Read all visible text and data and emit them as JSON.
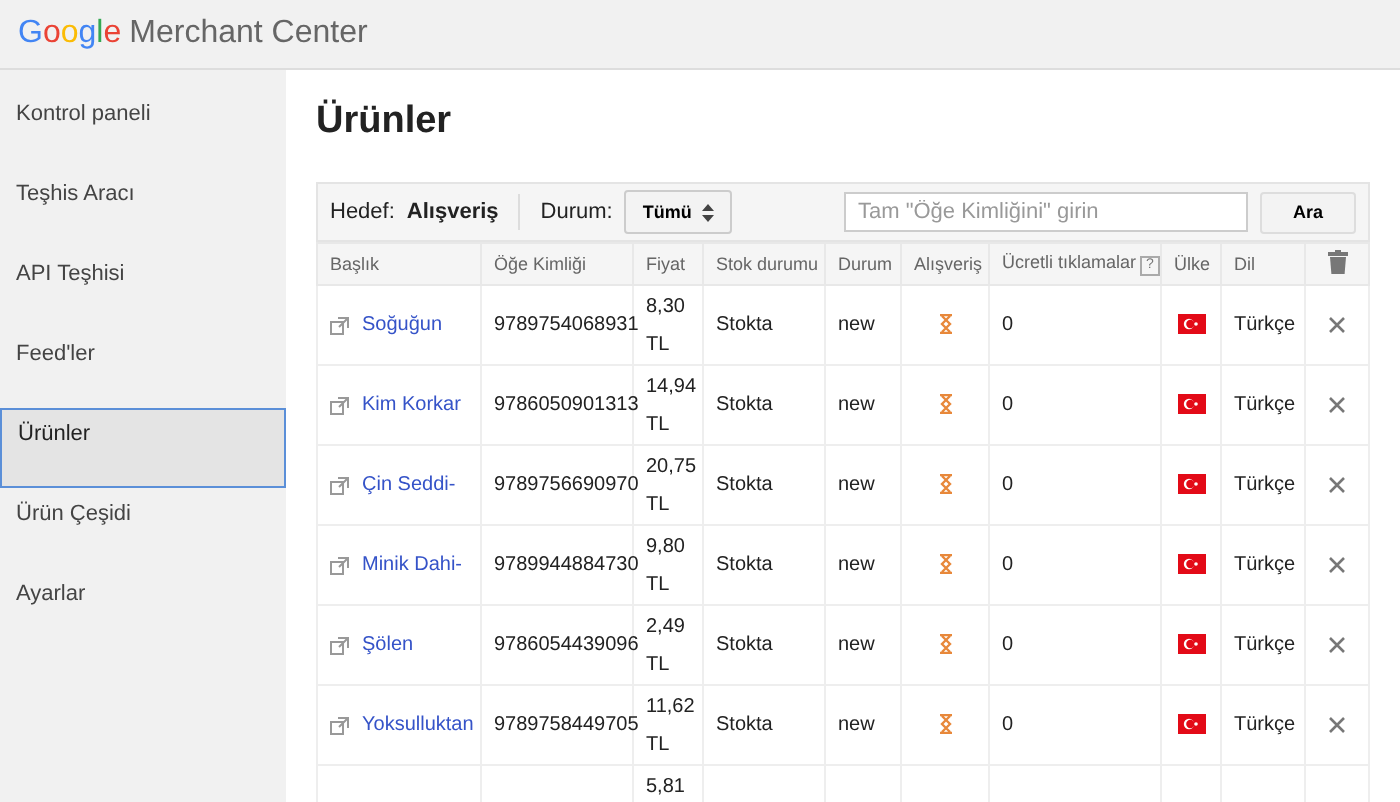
{
  "header": {
    "logo_word": "Google",
    "product": "Merchant Center"
  },
  "sidebar": {
    "items": [
      {
        "label": "Kontrol paneli",
        "selected": false
      },
      {
        "label": "Teşhis Aracı",
        "selected": false
      },
      {
        "label": "API Teşhisi",
        "selected": false
      },
      {
        "label": "Feed'ler",
        "selected": false
      },
      {
        "label": "Ürünler",
        "selected": true
      },
      {
        "label": "Ürün Çeşidi",
        "selected": false
      },
      {
        "label": "Ayarlar",
        "selected": false
      }
    ]
  },
  "page_title": "Ürünler",
  "toolbar": {
    "target_label": "Hedef:",
    "target_value": "Alışveriş",
    "status_label": "Durum:",
    "status_value": "Tümü",
    "search_placeholder": "Tam \"Öğe Kimliğini\" girin",
    "search_button": "Ara"
  },
  "table": {
    "columns": [
      {
        "label": "Başlık"
      },
      {
        "label": "Öğe Kimliği"
      },
      {
        "label": "Fiyat"
      },
      {
        "label": "Stok durumu"
      },
      {
        "label": "Durum"
      },
      {
        "label": "Alışveriş"
      },
      {
        "label": "Ücretli tıklamalar",
        "help": "?"
      },
      {
        "label": "Ülke"
      },
      {
        "label": "Dil"
      },
      {
        "kind": "trash"
      }
    ],
    "rows": [
      {
        "title": "Soğuğun",
        "id": "9789754068931",
        "price": "8,30 TL",
        "stock": "Stokta",
        "condition": "new",
        "clicks": "0",
        "language": "Türkçe"
      },
      {
        "title": "Kim Korkar",
        "id": "9786050901313",
        "price": "14,94 TL",
        "stock": "Stokta",
        "condition": "new",
        "clicks": "0",
        "language": "Türkçe"
      },
      {
        "title": "Çin Seddi-",
        "id": "9789756690970",
        "price": "20,75 TL",
        "stock": "Stokta",
        "condition": "new",
        "clicks": "0",
        "language": "Türkçe"
      },
      {
        "title": "Minik Dahi-",
        "id": "9789944884730",
        "price": "9,80 TL",
        "stock": "Stokta",
        "condition": "new",
        "clicks": "0",
        "language": "Türkçe"
      },
      {
        "title": "Şölen",
        "id": "9786054439096",
        "price": "2,49 TL",
        "stock": "Stokta",
        "condition": "new",
        "clicks": "0",
        "language": "Türkçe"
      },
      {
        "title": "Yoksulluktan",
        "id": "9789758449705",
        "price": "11,62 TL",
        "stock": "Stokta",
        "condition": "new",
        "clicks": "0",
        "language": "Türkçe"
      },
      {
        "price": "5,81"
      }
    ]
  }
}
